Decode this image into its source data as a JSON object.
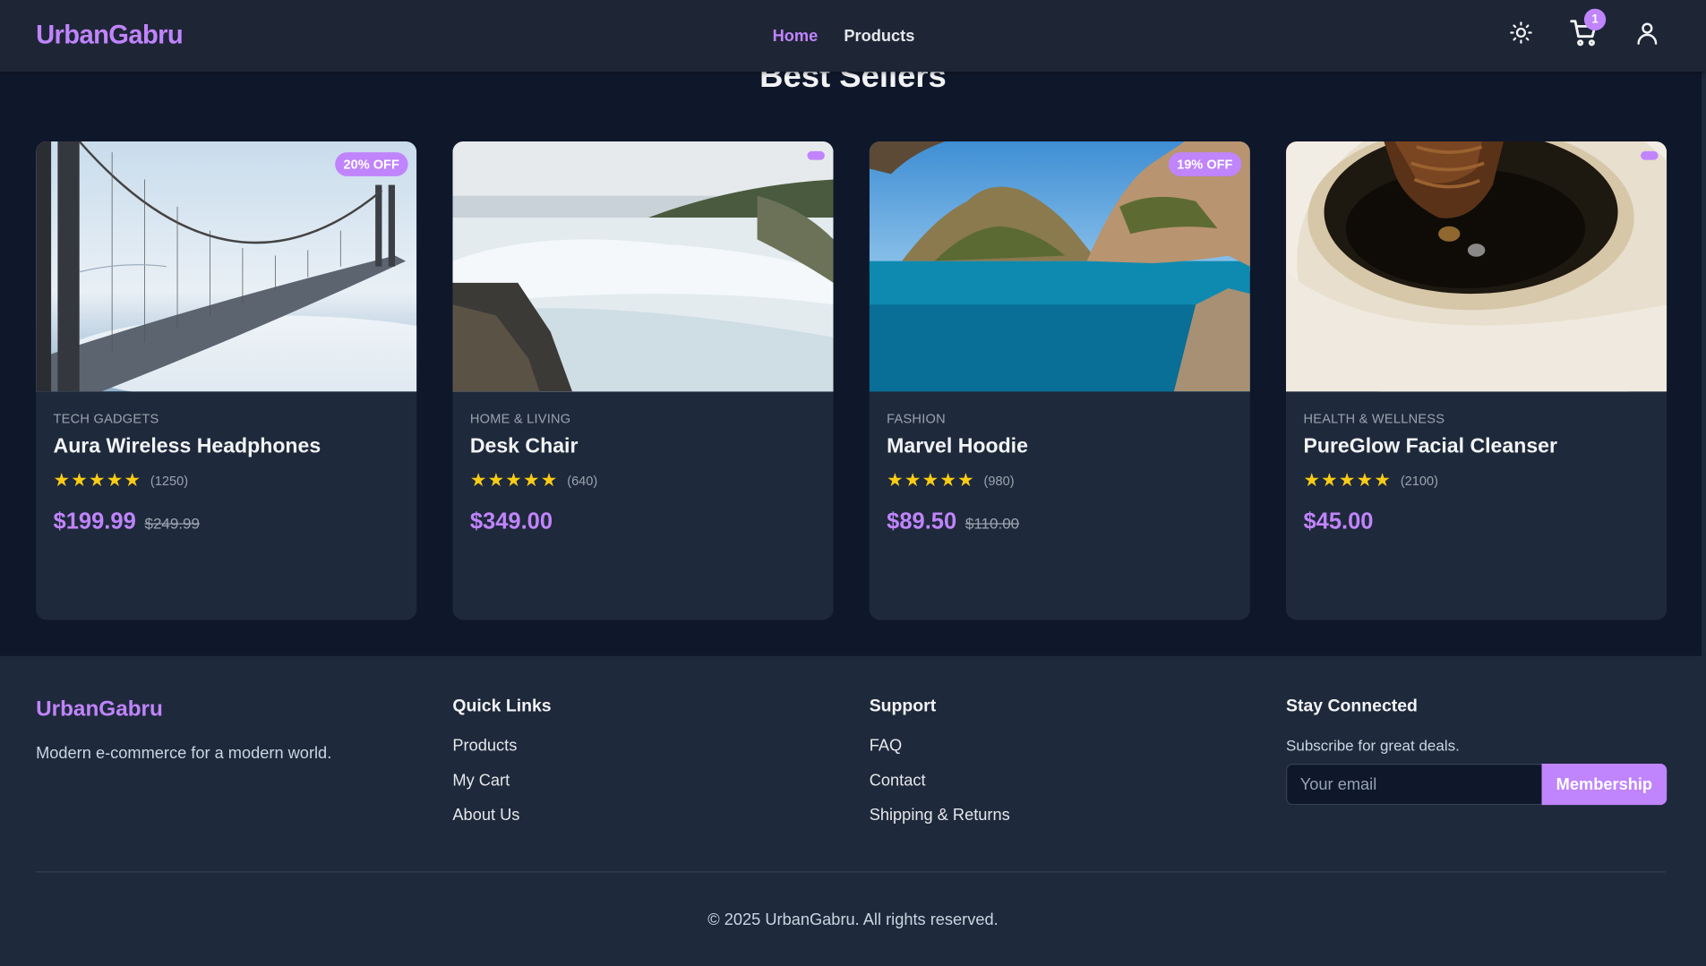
{
  "nav": {
    "logo": "UrbanGabru",
    "links": [
      "Home",
      "Products"
    ],
    "cart_count": "1",
    "icons": [
      "sun-icon",
      "cart-icon",
      "user-icon"
    ]
  },
  "section_title": "Best Sellers",
  "products": [
    {
      "category": "TECH GADGETS",
      "name": "Aura Wireless Headphones",
      "stars": "★★★★★",
      "reviews": "(1250)",
      "price": "$199.99",
      "old_price": "$249.99",
      "badge": "20% OFF"
    },
    {
      "category": "HOME & LIVING",
      "name": "Desk Chair",
      "stars": "★★★★★",
      "reviews": "(640)",
      "price": "$349.00",
      "old_price": "",
      "badge": ""
    },
    {
      "category": "FASHION",
      "name": "Marvel Hoodie",
      "stars": "★★★★★",
      "reviews": "(980)",
      "price": "$89.50",
      "old_price": "$110.00",
      "badge": "19% OFF"
    },
    {
      "category": "HEALTH & WELLNESS",
      "name": "PureGlow Facial Cleanser",
      "stars": "★★★★★",
      "reviews": "(2100)",
      "price": "$45.00",
      "old_price": "",
      "badge": ""
    }
  ],
  "footer": {
    "logo": "UrbanGabru",
    "tagline": "Modern e-commerce for a modern world.",
    "quick_links": {
      "heading": "Quick Links",
      "items": [
        "Products",
        "My Cart",
        "About Us"
      ]
    },
    "support": {
      "heading": "Support",
      "items": [
        "FAQ",
        "Contact",
        "Shipping & Returns"
      ]
    },
    "stay_connected": {
      "heading": "Stay Connected",
      "subtitle": "Subscribe for great deals.",
      "placeholder": "Your email",
      "button": "Membership"
    },
    "copyright": "© 2025 UrbanGabru. All rights reserved."
  },
  "colors": {
    "accent": "#c084fc",
    "star": "#facc15",
    "bg": "#0f172a",
    "card": "#1e293b"
  }
}
